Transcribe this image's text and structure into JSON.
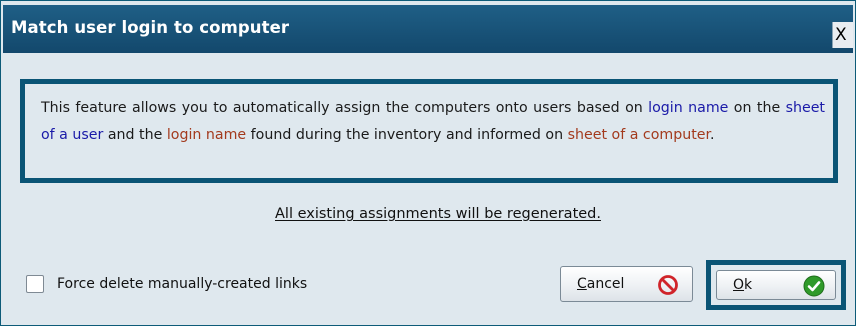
{
  "dialog": {
    "title": "Match user login to computer",
    "close_symbol": "X"
  },
  "description": {
    "part1": "This feature allows you to automatically assign the computers onto users based on ",
    "link_login_name": "login name",
    "part2": " on the ",
    "link_user_sheet": "sheet of a user",
    "part3": " and the ",
    "link_login_name_found": "login name",
    "part4": " found during the inventory and informed on ",
    "link_computer_sheet": "sheet of a computer",
    "part5": "."
  },
  "warning_text": "All existing assignments will be regenerated.",
  "checkbox": {
    "label": "Force delete manually-created links",
    "checked": false
  },
  "buttons": {
    "cancel": {
      "accel": "C",
      "rest": "ancel",
      "icon": "no-entry-icon"
    },
    "ok": {
      "accel": "O",
      "rest": "k",
      "icon": "checkmark-circle-icon"
    }
  },
  "colors": {
    "titlebar": "#1a5479",
    "highlight_border": "#0a5475",
    "link_blue": "#1a1aa8",
    "link_brown": "#a33a1d",
    "cancel_icon_red": "#d0242a",
    "ok_icon_green": "#2f9a2a"
  }
}
